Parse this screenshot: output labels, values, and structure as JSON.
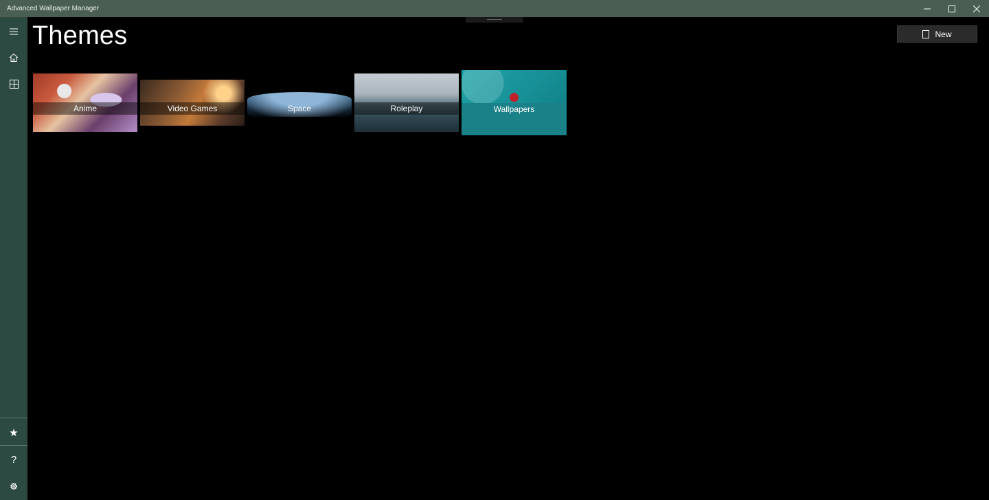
{
  "window": {
    "title": "Advanced Wallpaper Manager",
    "controls": {
      "minimize_icon": "minimize-icon",
      "maximize_icon": "maximize-icon",
      "close_icon": "close-icon"
    }
  },
  "sidebar": {
    "top_items": [
      {
        "icon": "hamburger-menu-icon"
      },
      {
        "icon": "home-icon"
      },
      {
        "icon": "grid-icon"
      }
    ],
    "bottom_items": [
      {
        "icon": "star-icon"
      },
      {
        "icon": "help-icon"
      },
      {
        "icon": "gear-icon"
      }
    ],
    "help_glyph": "?",
    "star_glyph": "★"
  },
  "page": {
    "title": "Themes",
    "new_button": {
      "label": "New",
      "icon": "new-page-icon"
    }
  },
  "themes": [
    {
      "label": "Anime"
    },
    {
      "label": "Video Games"
    },
    {
      "label": "Space"
    },
    {
      "label": "Roleplay"
    },
    {
      "label": "Wallpapers",
      "selected": true
    }
  ],
  "colors": {
    "titlebar": "#4a5e52",
    "sidebar": "#2d4a42",
    "background": "#000000",
    "selected_tile": "#1ea3a8"
  }
}
